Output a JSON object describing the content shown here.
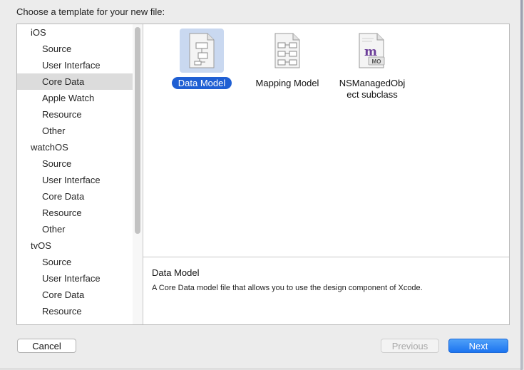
{
  "dialog": {
    "prompt": "Choose a template for your new file:"
  },
  "sidebar": {
    "sections": [
      {
        "platform": "iOS",
        "categories": [
          "Source",
          "User Interface",
          "Core Data",
          "Apple Watch",
          "Resource",
          "Other"
        ]
      },
      {
        "platform": "watchOS",
        "categories": [
          "Source",
          "User Interface",
          "Core Data",
          "Resource",
          "Other"
        ]
      },
      {
        "platform": "tvOS",
        "categories": [
          "Source",
          "User Interface",
          "Core Data",
          "Resource"
        ]
      }
    ],
    "selected": "iOS / Core Data"
  },
  "templates": [
    {
      "name": "Data Model",
      "icon": "data-model-document-icon",
      "selected": true
    },
    {
      "name": "Mapping Model",
      "icon": "mapping-model-document-icon",
      "selected": false
    },
    {
      "name": "NSManagedObject subclass",
      "label_lines": [
        "NSManagedObj",
        "ect subclass"
      ],
      "icon": "managed-object-subclass-icon",
      "badge": "MO",
      "selected": false
    }
  ],
  "description": {
    "title": "Data Model",
    "body": "A Core Data model file that allows you to use the design component of Xcode."
  },
  "buttons": {
    "cancel": "Cancel",
    "previous": "Previous",
    "next": "Next",
    "previous_enabled": false
  },
  "colors": {
    "accent": "#1f5fd3",
    "next_button": "#2b7ff2",
    "selection_tint": "#c9d8f0"
  }
}
